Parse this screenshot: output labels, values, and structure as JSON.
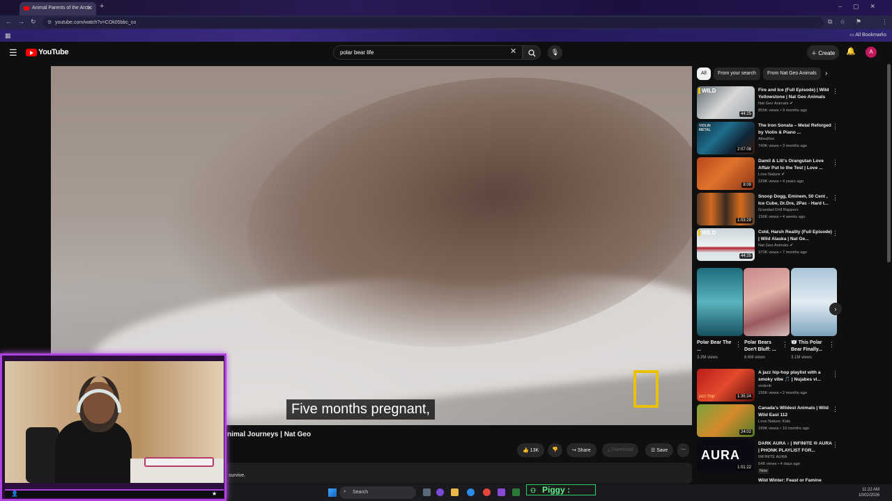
{
  "browser": {
    "tab_title": "Animal Parents of the Arctic",
    "new_tab": "+",
    "url": "youtube.com/watch?v=COk05bbc_co",
    "bookmarks_label": "All Bookmarks",
    "profile_initial": "A"
  },
  "header": {
    "logo_text": "YouTube",
    "search_value": "polar bear life",
    "create_label": "Create",
    "avatar_initial": "A"
  },
  "player": {
    "caption": "Five months pregnant,"
  },
  "video": {
    "title": "nimal Journeys | Nat Geo",
    "likes": "13K",
    "share": "Share",
    "download": "Download",
    "save": "Save",
    "description_snippet": "survive."
  },
  "chips": [
    "All",
    "From your search",
    "From Nat Geo Animals"
  ],
  "recommendations": [
    {
      "title": "Fire and Ice (Full Episode) | Wild Yellowstone | Nat Geo Animals",
      "channel": "Nat Geo Animals",
      "meta": "855K views • 9 months ago",
      "duration": "44:25",
      "tag": "WILD"
    },
    {
      "title": "The Iron Sonata – Metal Reforged by Violin & Piano ...",
      "channel": "AltosRox",
      "meta": "743K views • 3 months ago",
      "duration": "2:07:08",
      "tag": "VIOLIN METAL"
    },
    {
      "title": "Damil & Liti's Orangutan Love Affair Put to the Test | Love ...",
      "channel": "Love Nature",
      "meta": "229K views • 4 years ago",
      "duration": "8:09",
      "tag": ""
    },
    {
      "title": "Snoop Dogg, Eminem, 50 Cent , Ice Cube, Dr.Dre, 2Pac - Hard t...",
      "channel": "Grandad Drill Rappers",
      "meta": "156K views • 4 weeks ago",
      "duration": "1:03:29",
      "tag": ""
    },
    {
      "title": "Cold, Harsh Reality (Full Episode) | Wild Alaska | Nat Ge...",
      "channel": "Nat Geo Animals",
      "meta": "373K views • 7 months ago",
      "duration": "44:25",
      "tag": "WILD"
    },
    {
      "title": "A jazz hip-hop playlist with a smoky vibe 🎵 | Nujabes vi...",
      "channel": "ondsnb",
      "meta": "155K views • 2 months ago",
      "duration": "1:35:24",
      "tag": "jazz hop"
    },
    {
      "title": "Canada's Wildest Animals | Wild Wild East 112",
      "channel": "Love Nature: Kids",
      "meta": "189K views • 10 months ago",
      "duration": "24:02",
      "tag": ""
    },
    {
      "title": "DARK AURA ♪ | INFINITE ♾ AURA | PHONK PLAYLIST FOR...",
      "channel": "INFINITE AURA",
      "meta": "54K views • 4 days ago",
      "duration": "1:01:22",
      "tag": "AURA",
      "badge": "New"
    }
  ],
  "shorts": [
    {
      "title": "Polar Bear The ...",
      "views": "3.3M views"
    },
    {
      "title": "Polar Bears Don't Bluff: ...",
      "views": "6.6M views"
    },
    {
      "title": "🐻‍❄️ This Polar Bear Finally...",
      "views": "3.1M views"
    }
  ],
  "next_partial_title": "Wild Winter: Feast or Famine",
  "taskbar": {
    "search": "Search",
    "piggy": "Piggy :",
    "time": "11:22 AM",
    "date": "10/02/2026"
  },
  "colors": {
    "yt_red": "#ff0000",
    "webcam_border": "#b043e0",
    "piggy_green": "#62f58e",
    "nat_geo_yellow": "#e8c100"
  }
}
